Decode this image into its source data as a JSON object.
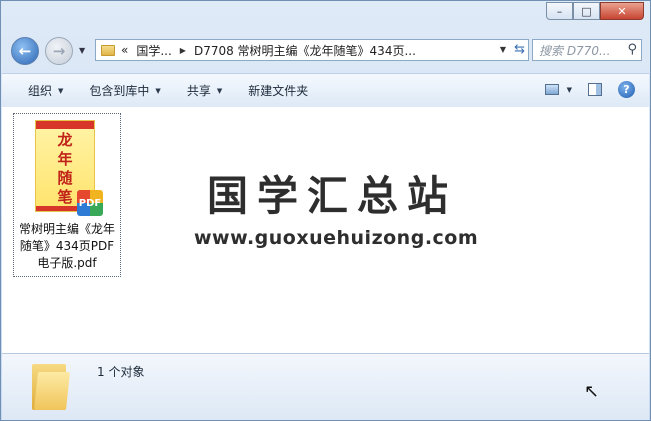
{
  "window": {
    "caption": {
      "minimize": "–",
      "maximize": "□",
      "close": "✕"
    }
  },
  "nav": {
    "back_icon": "back-arrow",
    "forward_icon": "forward-arrow"
  },
  "address": {
    "overflow": "«",
    "segments": [
      "国学...",
      "D7708 常树明主编《龙年随笔》434页..."
    ],
    "refresh_icon": "refresh"
  },
  "search": {
    "placeholder": "搜索 D770..."
  },
  "toolbar": {
    "organize": "组织",
    "include_library": "包含到库中",
    "share": "共享",
    "new_folder": "新建文件夹"
  },
  "file": {
    "name": "常树明主编《龙年随笔》434页PDF电子版.pdf",
    "thumb_title": "龙年随笔",
    "badge": "PDF"
  },
  "watermark": {
    "title": "国学汇总站",
    "url": "www.guoxuehuizong.com"
  },
  "details": {
    "count": "1 个对象"
  },
  "colors": {
    "accent": "#2b66b4",
    "folder": "#f0c55a",
    "badge_red": "#e6482f"
  }
}
